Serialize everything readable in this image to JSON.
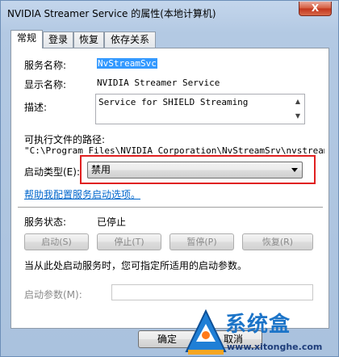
{
  "window": {
    "title": "NVIDIA Streamer Service 的属性(本地计算机)",
    "close_glyph": "X"
  },
  "tabs": [
    {
      "label": "常规",
      "active": true
    },
    {
      "label": "登录",
      "active": false
    },
    {
      "label": "恢复",
      "active": false
    },
    {
      "label": "依存关系",
      "active": false
    }
  ],
  "general": {
    "service_name_label": "服务名称:",
    "service_name_value": "NvStreamSvc",
    "display_name_label": "显示名称:",
    "display_name_value": "NVIDIA Streamer Service",
    "description_label": "描述:",
    "description_value": "Service for SHIELD Streaming",
    "exe_path_label": "可执行文件的路径:",
    "exe_path_value": "\"C:\\Program Files\\NVIDIA Corporation\\NvStreamSrv\\nvstreamsvc",
    "startup_type_label": "启动类型(E):",
    "startup_type_value": "禁用",
    "help_link": "帮助我配置服务启动选项。",
    "status_label": "服务状态:",
    "status_value": "已停止",
    "buttons": {
      "start": "启动(S)",
      "stop": "停止(T)",
      "pause": "暂停(P)",
      "resume": "恢复(R)"
    },
    "start_params_hint": "当从此处启动服务时，您可指定所适用的启动参数。",
    "start_params_label": "启动参数(M):",
    "start_params_value": ""
  },
  "footer": {
    "ok": "确定",
    "cancel": "取消"
  },
  "watermark": {
    "brand": "系统盒",
    "url": "www.xitonghe.com"
  }
}
